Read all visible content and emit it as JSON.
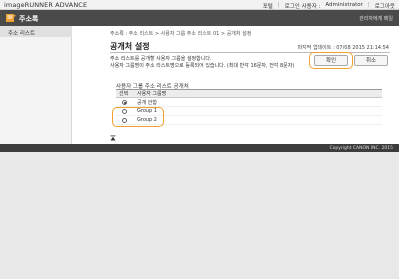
{
  "header": {
    "brand": "imageRUNNER ADVANCE",
    "links": {
      "portal": "포털",
      "login_user_label": "로그인 사용자 :",
      "login_user": "Administrator",
      "logout": "로그아웃"
    }
  },
  "titlebar": {
    "title": "주소록",
    "admin_mail": "관리자에게 메일"
  },
  "sidebar": {
    "items": [
      {
        "label": "주소 리스트"
      }
    ]
  },
  "main": {
    "breadcrumb": "주소록 : 주소 리스트 > 사용자 그룹 주소 리스트 01 > 공개처 설정",
    "title": "공개처 설정",
    "last_update": "마지막 업데이트 : 07/08 2015 21:14:54",
    "description": [
      "주소 리스트를 공개할 사용자 그룹을 설정합니다.",
      "사용자 그룹명이 주소 리스트명으로 등록되어 있습니다. (최대 반각 16문자, 전각 8문자)"
    ],
    "buttons": {
      "ok": "확인",
      "cancel": "취소"
    },
    "section_title": "사용자 그룹 주소 리스트 공개처",
    "table": {
      "headers": [
        "선택",
        "사용자 그룹명"
      ],
      "rows": [
        {
          "label": "공개 안함",
          "selected": true
        },
        {
          "label": "Group 1",
          "selected": false
        },
        {
          "label": "Group 2",
          "selected": false
        }
      ]
    }
  },
  "footer": {
    "copyright": "Copyright CANON INC. 2015"
  },
  "colors": {
    "highlight": "#f0a030",
    "titlebar": "#4a4a4a",
    "footer": "#3c3c3c"
  }
}
